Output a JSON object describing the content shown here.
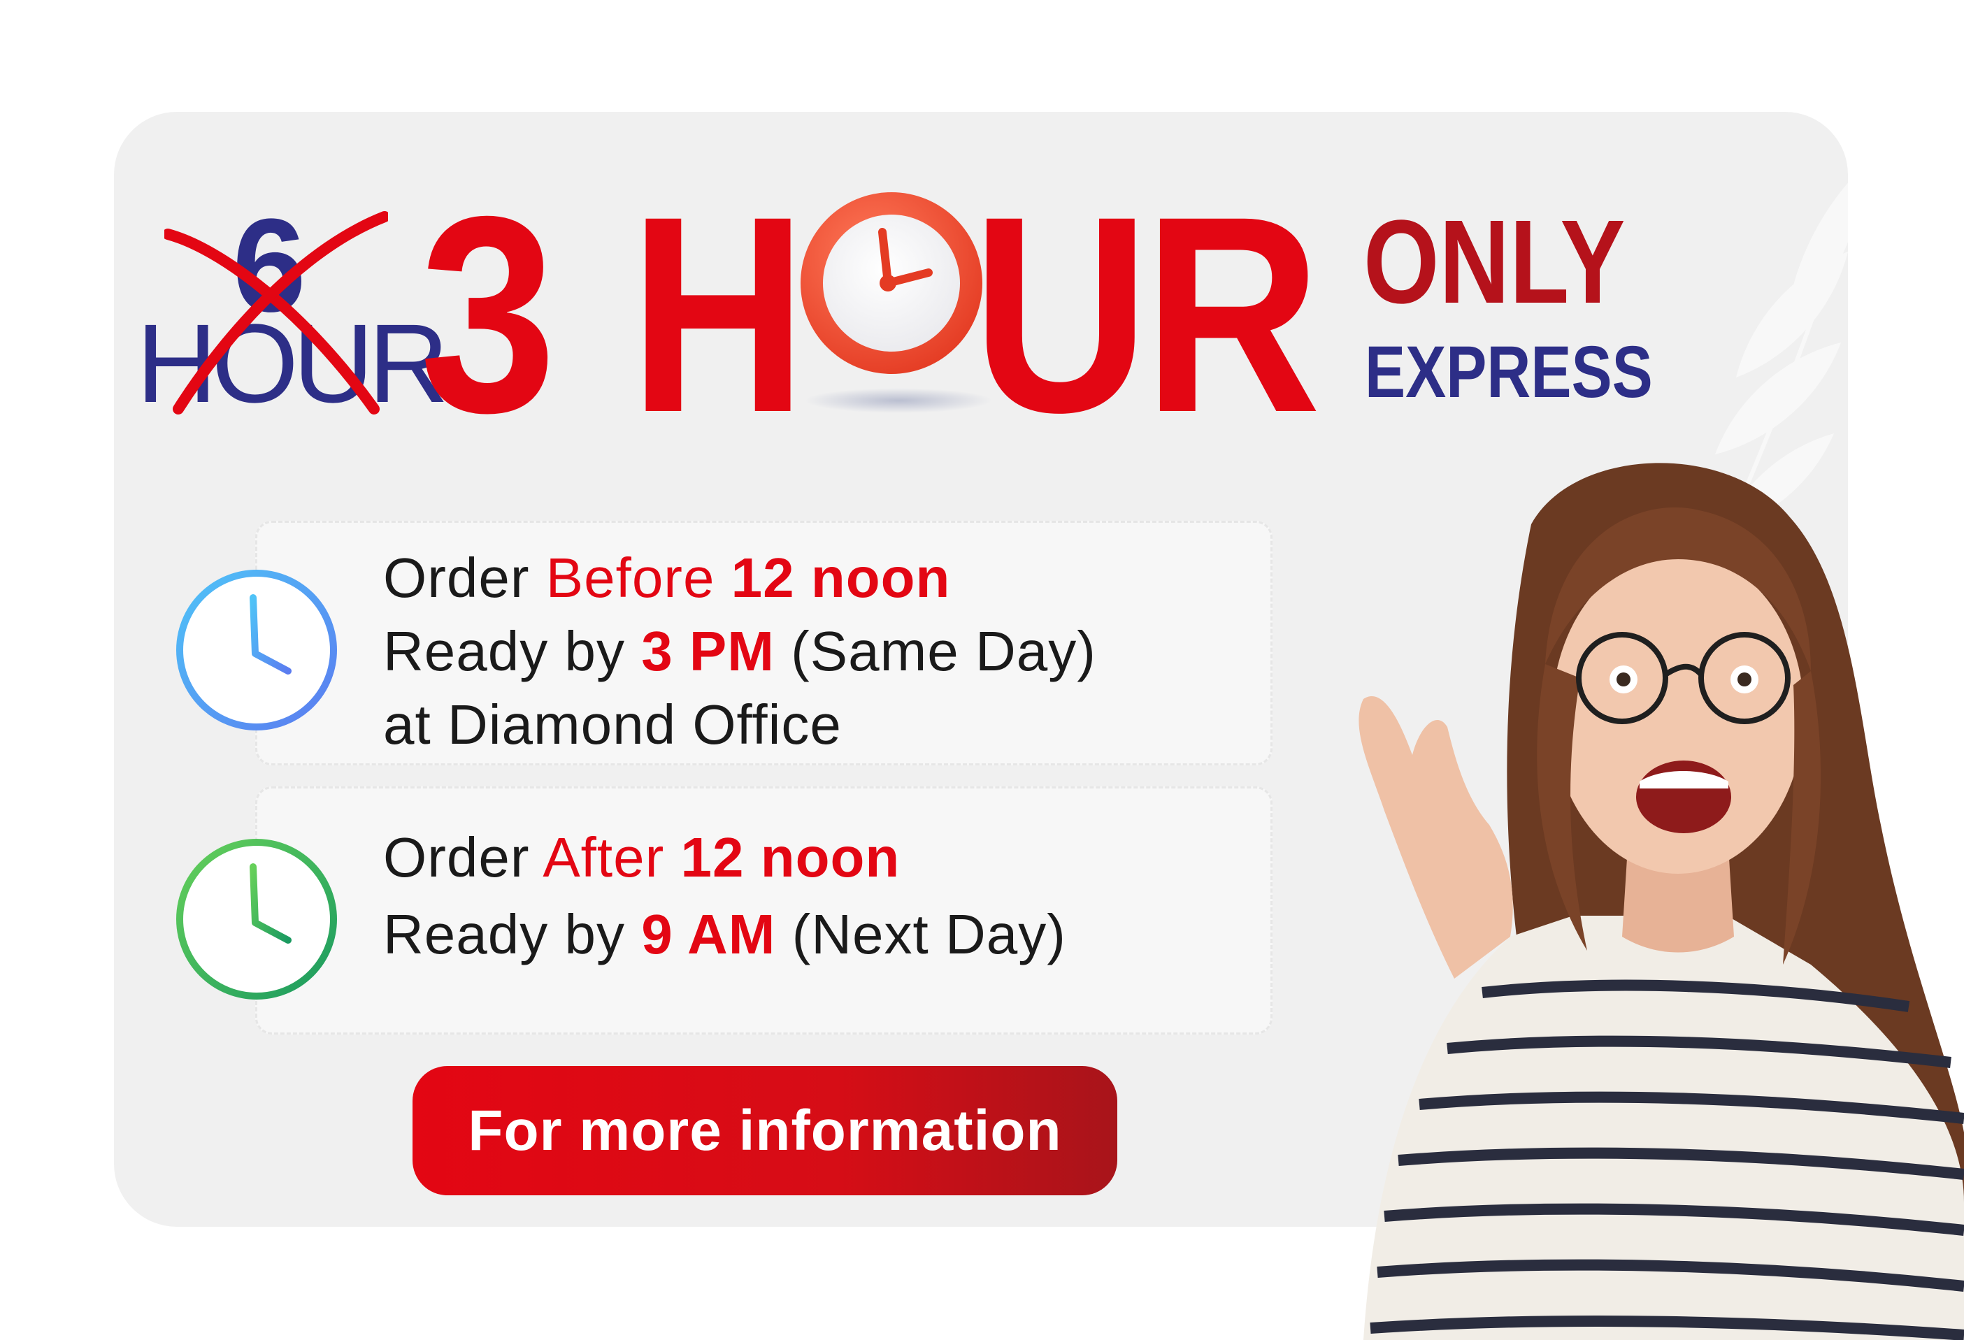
{
  "headline": {
    "old_number": "6",
    "old_word": "HOUR",
    "number": "3",
    "word_h": "H",
    "word_o_icon": "alarm-clock-icon",
    "word_rest": "UR",
    "only": "ONLY",
    "express": "EXPRESS"
  },
  "options": [
    {
      "icon": "clock-icon",
      "icon_colors": [
        "#4fc3f7",
        "#5b7cf0"
      ],
      "line1": {
        "prefix": "Order",
        "highlight": "Before",
        "time": "12 noon"
      },
      "line2": {
        "prefix": "Ready by",
        "time": "3 PM",
        "suffix": "(Same Day)"
      },
      "line3": "at Diamond Office"
    },
    {
      "icon": "clock-icon",
      "icon_colors": [
        "#66d05a",
        "#1a9a60"
      ],
      "line1": {
        "prefix": "Order",
        "highlight": "After",
        "time": "12 noon"
      },
      "line2": {
        "prefix": "Ready by",
        "time": "9 AM",
        "suffix": "(Next Day)"
      }
    }
  ],
  "cta": {
    "label": "For more information"
  },
  "colors": {
    "red": "#e30613",
    "navy": "#2d2e87",
    "dark_red": "#b5121b",
    "card": "#f0f0f0"
  }
}
